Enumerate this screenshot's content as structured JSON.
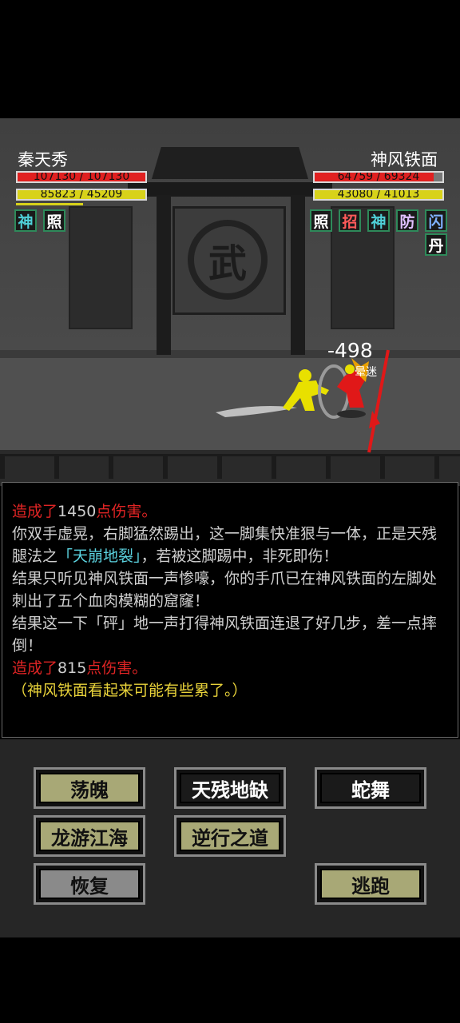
{
  "player": {
    "name": "秦天秀",
    "hp_text": "107130 / 107130",
    "hp_fraction": 1.0,
    "inner_text": "85823 / 45209",
    "inner_fraction": 1.0,
    "statuses": [
      {
        "label": "神",
        "color": "#4fd0d8"
      },
      {
        "label": "照",
        "color": "#ffffff"
      }
    ]
  },
  "enemy": {
    "name": "神风铁面",
    "hp_text": "64759 / 69324",
    "hp_fraction": 0.93,
    "inner_text": "43080 / 41013",
    "inner_fraction": 1.0,
    "statuses": [
      {
        "label": "照",
        "color": "#ffffff"
      },
      {
        "label": "招",
        "color": "#ff5a5a"
      },
      {
        "label": "神",
        "color": "#4fd0d8"
      },
      {
        "label": "防",
        "color": "#e0c0ff"
      },
      {
        "label": "闪",
        "color": "#7fb0ff"
      },
      {
        "label": "丹",
        "color": "#ffffff"
      }
    ]
  },
  "scene": {
    "plaque_char": "武",
    "damage_popup": "-498",
    "enemy_state": "晕迷"
  },
  "log": {
    "line1_prefix": "造成了",
    "line1_value": "1450",
    "line1_suffix": "点伤害。",
    "para1_a": "你双手虚晃，右脚猛然踢出，这一脚集快准狠与一体，正是天残腿法之",
    "para1_skill": "「天崩地裂」",
    "para1_b": "，若被这脚踢中，非死即伤！",
    "para2": "结果只听见神风铁面一声惨嚎，你的手爪已在神风铁面的左脚处刺出了五个血肉模糊的窟窿！",
    "para3": "结果这一下「砰」地一声打得神风铁面连退了好几步，差一点摔倒！",
    "line2_prefix": "造成了",
    "line2_value": "815",
    "line2_suffix": "点伤害。",
    "status_line": "（神风铁面看起来可能有些累了。）"
  },
  "actions": {
    "skill1": "荡魄",
    "skill2": "天残地缺",
    "skill3": "蛇舞",
    "skill4": "龙游江海",
    "skill5": "逆行之道",
    "recover": "恢复",
    "escape": "逃跑"
  },
  "colors": {
    "hp": "#e02020",
    "inner": "#d8d21a",
    "player_sprite": "#e8e000",
    "enemy_sprite": "#e01818"
  }
}
